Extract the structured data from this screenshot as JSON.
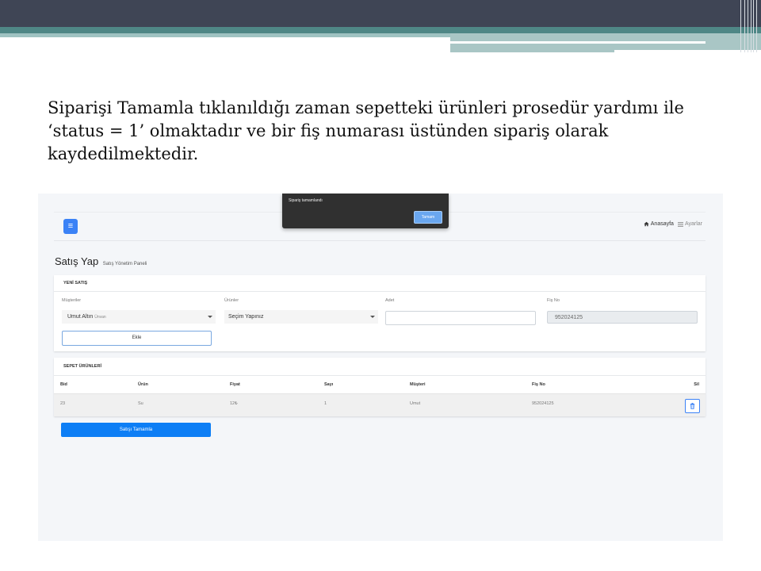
{
  "slide": {
    "text": "Siparişi Tamamla tıklanıldığı zaman sepetteki ürünleri prosedür yardımı ile ‘status = 1’ olmaktadır ve bir fiş numarası üstünden sipariş olarak kaydedilmektedir."
  },
  "dialog": {
    "message": "Sipariş tamamlandı",
    "ok_label": "Tamam"
  },
  "navbar": {
    "home_label": "Anasayfa",
    "settings_label": "Ayarlar"
  },
  "page": {
    "title": "Satış Yap",
    "subtitle": "Satış Yönetim Paneli"
  },
  "new_sale": {
    "header": "YENİ SATIŞ",
    "customers_label": "Müşteriler",
    "customer_name": "Umut Altın",
    "customer_title": "Ünvan",
    "products_label": "Ürünler",
    "product_value": "Seçim Yapınız",
    "quantity_label": "Adet",
    "quantity_value": "",
    "receipt_label": "Fiş No",
    "receipt_value": "952024125",
    "add_label": "Ekle"
  },
  "cart": {
    "header": "SEPET ÜRÜNLERİ",
    "columns": [
      "Bid",
      "Ürün",
      "Fiyat",
      "Sayı",
      "Müşteri",
      "Fiş No",
      "Sil"
    ],
    "rows": [
      {
        "bid": "23",
        "product": "Su",
        "price": "12₺",
        "count": "1",
        "customer": "Umut",
        "receipt": "952024125"
      }
    ]
  },
  "complete_label": "Satışı Tamamla",
  "colors": {
    "primary": "#0d7ef5",
    "dialog_bg": "#303030",
    "slide_header": "#3f4555",
    "slide_accent": "#4f8786"
  }
}
